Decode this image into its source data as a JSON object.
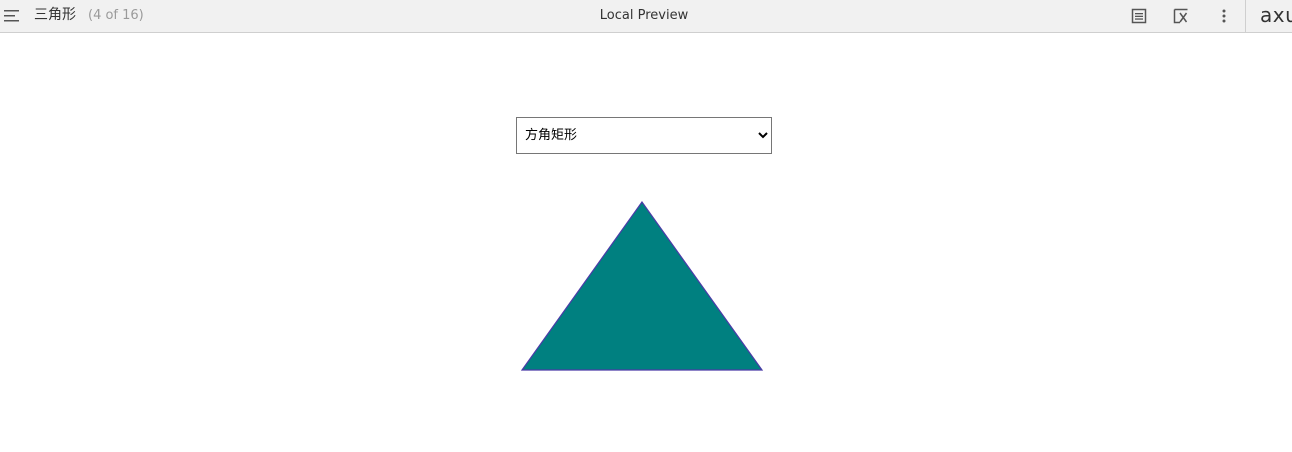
{
  "topbar": {
    "page_title": "三角形",
    "page_count": "(4 of 16)",
    "center_title": "Local Preview",
    "brand": "axu"
  },
  "tools": {
    "menu_icon": "hamburger-menu-icon",
    "notes_icon": "document-icon",
    "variables_icon": "function-x-icon",
    "more_icon": "vertical-ellipsis-icon"
  },
  "main": {
    "select": {
      "selected": "方角矩形"
    },
    "shape": {
      "name": "triangle",
      "fill": "#008080",
      "stroke": "#4b3aa8"
    }
  }
}
